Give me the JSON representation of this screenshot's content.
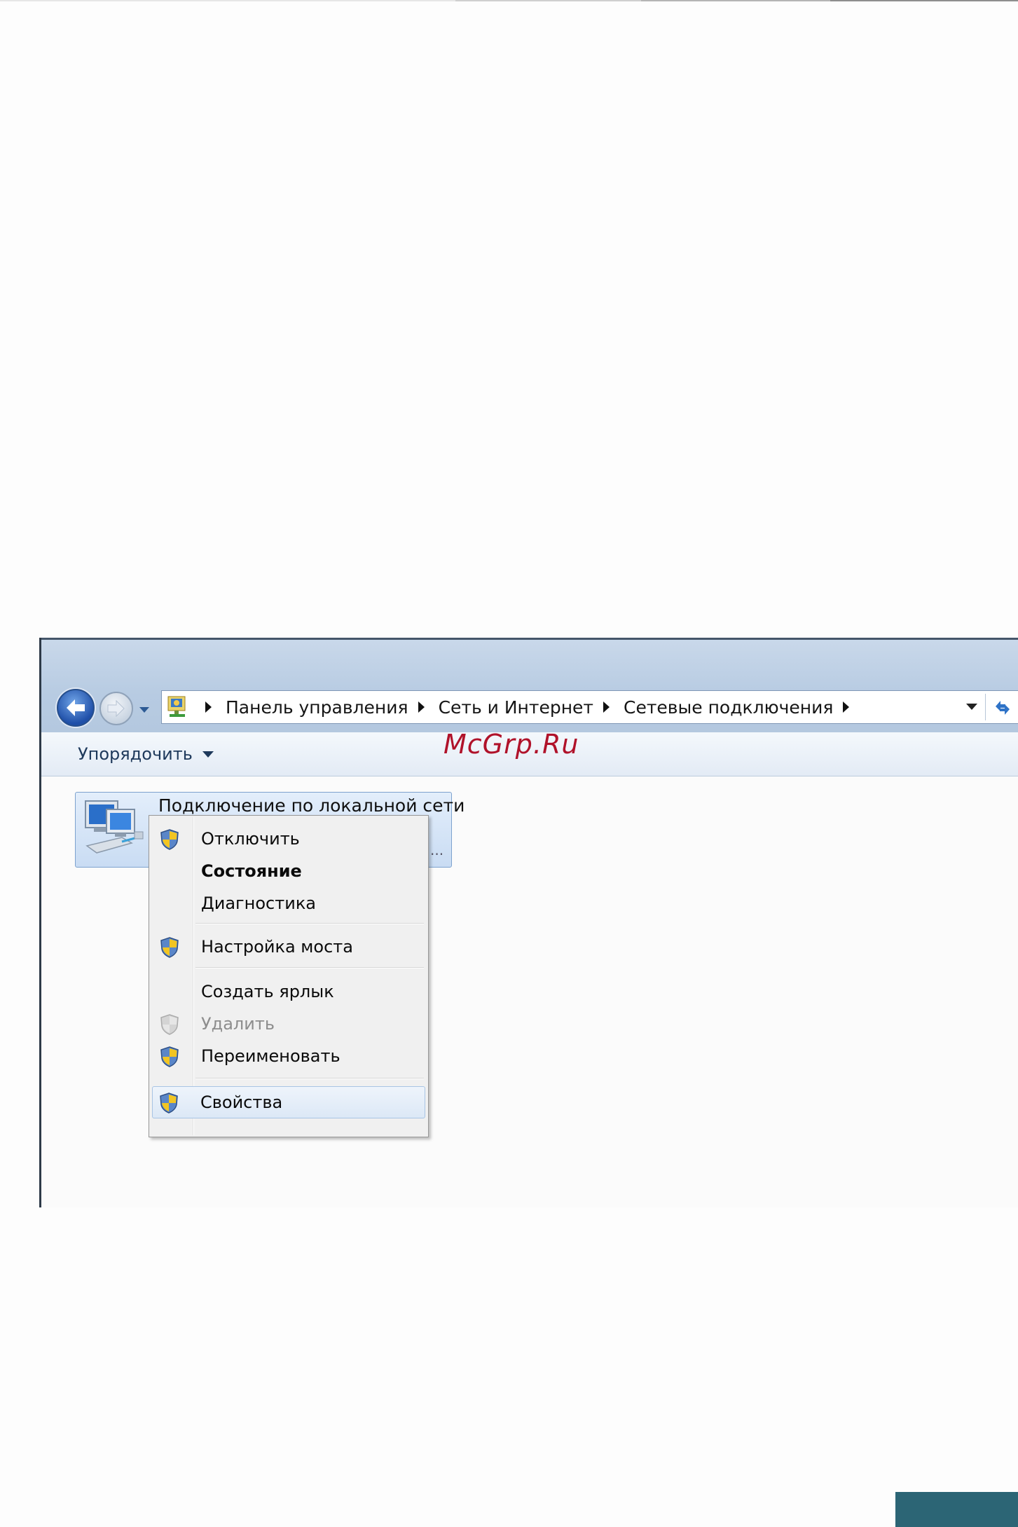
{
  "colors": {
    "page_background": "#fdfdfd",
    "titlebar": "#c3d4e8",
    "toolbar": "#eaf0f7",
    "watermark": "#b0122a",
    "corner_tab": "#2c6575",
    "menu_background": "#f0f0f0"
  },
  "window": {
    "navigation": {
      "back_icon": "back-arrow-icon",
      "forward_icon": "forward-arrow-icon",
      "history_dropdown_icon": "chevron-down-icon"
    },
    "address_bar": {
      "location_icon": "network-connections-icon",
      "breadcrumbs": [
        "Панель управления",
        "Сеть и Интернет",
        "Сетевые подключения"
      ],
      "dropdown_icon": "chevron-down-icon",
      "refresh_icon": "refresh-icon"
    },
    "toolbar": {
      "organize_label": "Упорядочить"
    },
    "watermark": "McGrp.Ru",
    "connection": {
      "name": "Подключение по локальной сети",
      "ellipsis": "...",
      "icon": "network-adapter-icon"
    },
    "context_menu": {
      "items": [
        {
          "label": "Отключить",
          "icon": "uac-shield-icon",
          "bold": false,
          "disabled": false
        },
        {
          "label": "Состояние",
          "icon": "",
          "bold": true,
          "disabled": false
        },
        {
          "label": "Диагностика",
          "icon": "",
          "bold": false,
          "disabled": false
        },
        {
          "label": "Настройка моста",
          "icon": "uac-shield-icon",
          "bold": false,
          "disabled": false
        },
        {
          "label": "Создать ярлык",
          "icon": "",
          "bold": false,
          "disabled": false
        },
        {
          "label": "Удалить",
          "icon": "uac-shield-icon",
          "bold": false,
          "disabled": true
        },
        {
          "label": "Переименовать",
          "icon": "uac-shield-icon",
          "bold": false,
          "disabled": false
        },
        {
          "label": "Свойства",
          "icon": "uac-shield-icon",
          "bold": false,
          "disabled": false,
          "highlighted": true
        }
      ]
    }
  }
}
